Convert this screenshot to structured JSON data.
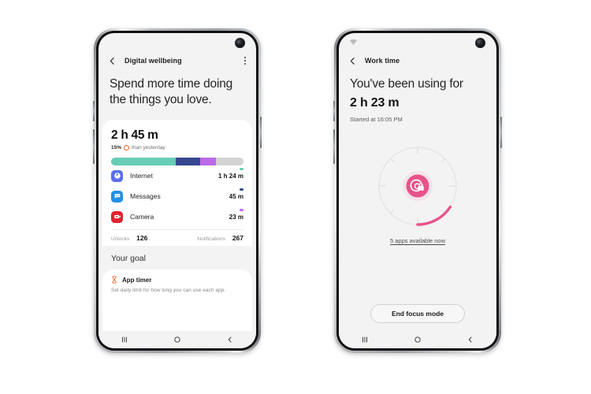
{
  "phones": [
    {
      "id": "digital-wellbeing",
      "statusbar": {
        "wifi": false,
        "camera": "front-camera-punch-hole"
      },
      "appbar": {
        "back_icon": "chevron-left-icon",
        "title": "Digital wellbeing",
        "overflow_icon": "kebab-menu-icon"
      },
      "hero": {
        "headline": "Spend more time doing the things you love."
      },
      "summary_card": {
        "total_time": "2 h 45 m",
        "delta_percent": "15%",
        "delta_icon": "down-arrow-circle-icon",
        "delta_color": "#f4622a",
        "delta_text": "than yesterday",
        "usage_bar": [
          {
            "label": "Internet",
            "percent": 49,
            "color": "#68cdb4"
          },
          {
            "label": "Messages",
            "percent": 18,
            "color": "#36478f"
          },
          {
            "label": "Camera",
            "percent": 12,
            "color": "#bb6ae8"
          },
          {
            "label": "Other",
            "percent": 21,
            "color": "#d4d4d4"
          }
        ],
        "apps": [
          {
            "name": "Internet",
            "time": "1 h 24 m",
            "icon": "internet-browser-icon",
            "icon_bg": "#5b6ef0",
            "dot_color": "#68cdb4"
          },
          {
            "name": "Messages",
            "time": "45 m",
            "icon": "messages-icon",
            "icon_bg": "#1f8fe8",
            "dot_color": "#36478f"
          },
          {
            "name": "Camera",
            "time": "23 m",
            "icon": "camera-icon",
            "icon_bg": "#e4222f",
            "dot_color": "#bb6ae8"
          }
        ],
        "stats": [
          {
            "label": "Unlocks",
            "value": "126"
          },
          {
            "label": "Notifications",
            "value": "267"
          }
        ]
      },
      "goal": {
        "section_title": "Your goal",
        "item_icon": "hourglass-icon",
        "item_icon_color": "#f4622a",
        "item_title": "App timer",
        "item_desc": "Set daily limit for how long you can use each app."
      },
      "navbar": {
        "recents_icon": "recents-icon",
        "home_icon": "home-circle-icon",
        "back_icon": "back-chevron-icon"
      }
    },
    {
      "id": "work-time",
      "statusbar": {
        "wifi": true,
        "wifi_icon": "wifi-icon",
        "camera": "front-camera-punch-hole"
      },
      "appbar": {
        "back_icon": "chevron-left-icon",
        "title": "Work time",
        "overflow_icon": null
      },
      "hero": {
        "headline": "You've been using for",
        "duration": "2 h 23 m",
        "started_at": "Started at 16:05 PM"
      },
      "focus_dial": {
        "center_icon": "focus-mode-lock-icon",
        "accent_color": "#e8538a",
        "track_color": "#e6e6e6",
        "progress_percent": 30,
        "caption": "5 apps available now"
      },
      "cta": {
        "label": "End focus mode"
      },
      "navbar": {
        "recents_icon": "recents-icon",
        "home_icon": "home-circle-icon",
        "back_icon": "back-chevron-icon"
      }
    }
  ]
}
